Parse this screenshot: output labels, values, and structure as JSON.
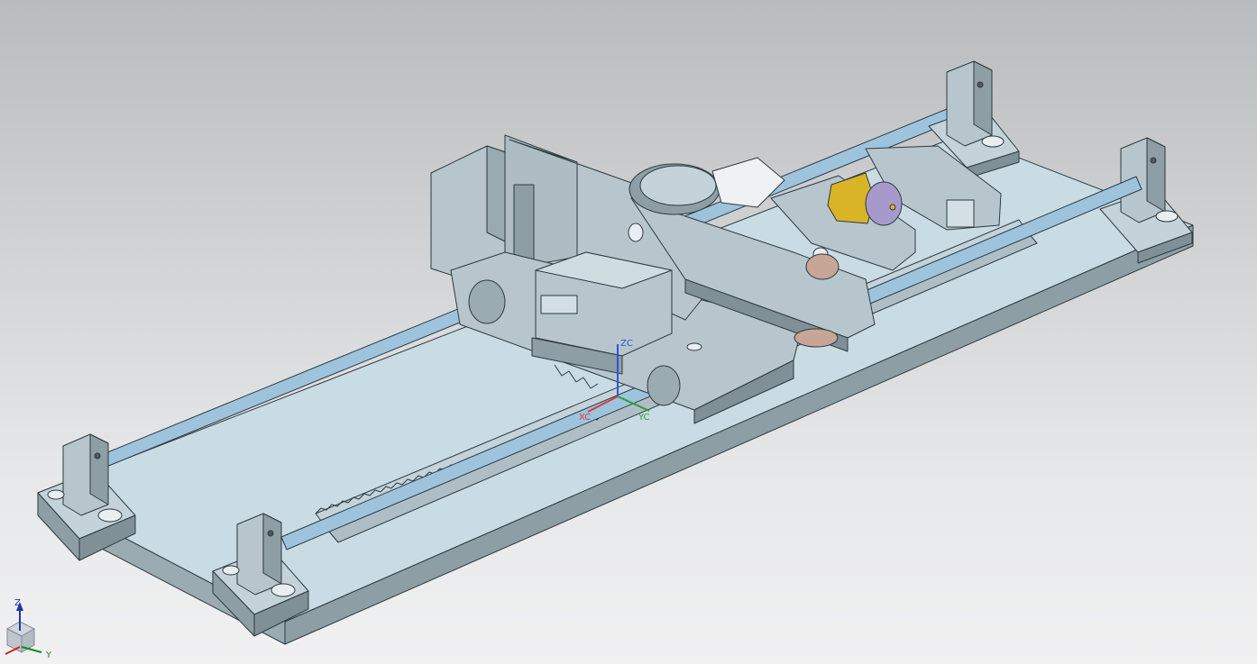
{
  "csys": {
    "xc": "XC",
    "yc": "YC",
    "zc": "ZC"
  },
  "triad": {
    "z": "Z",
    "y": "Y"
  },
  "colors": {
    "plate_top": "#c9dbe3",
    "plate_side": "#8d9ea4",
    "part": "#b7c6cc",
    "part_dark": "#7f9096",
    "rod": "#9ec3dd",
    "motor_yellow": "#d8b426",
    "motor_purple": "#a79acb",
    "edge": "#2e3a40",
    "xc": "#d63b3b",
    "yc": "#2e9b3a",
    "zc": "#2f54d6"
  }
}
